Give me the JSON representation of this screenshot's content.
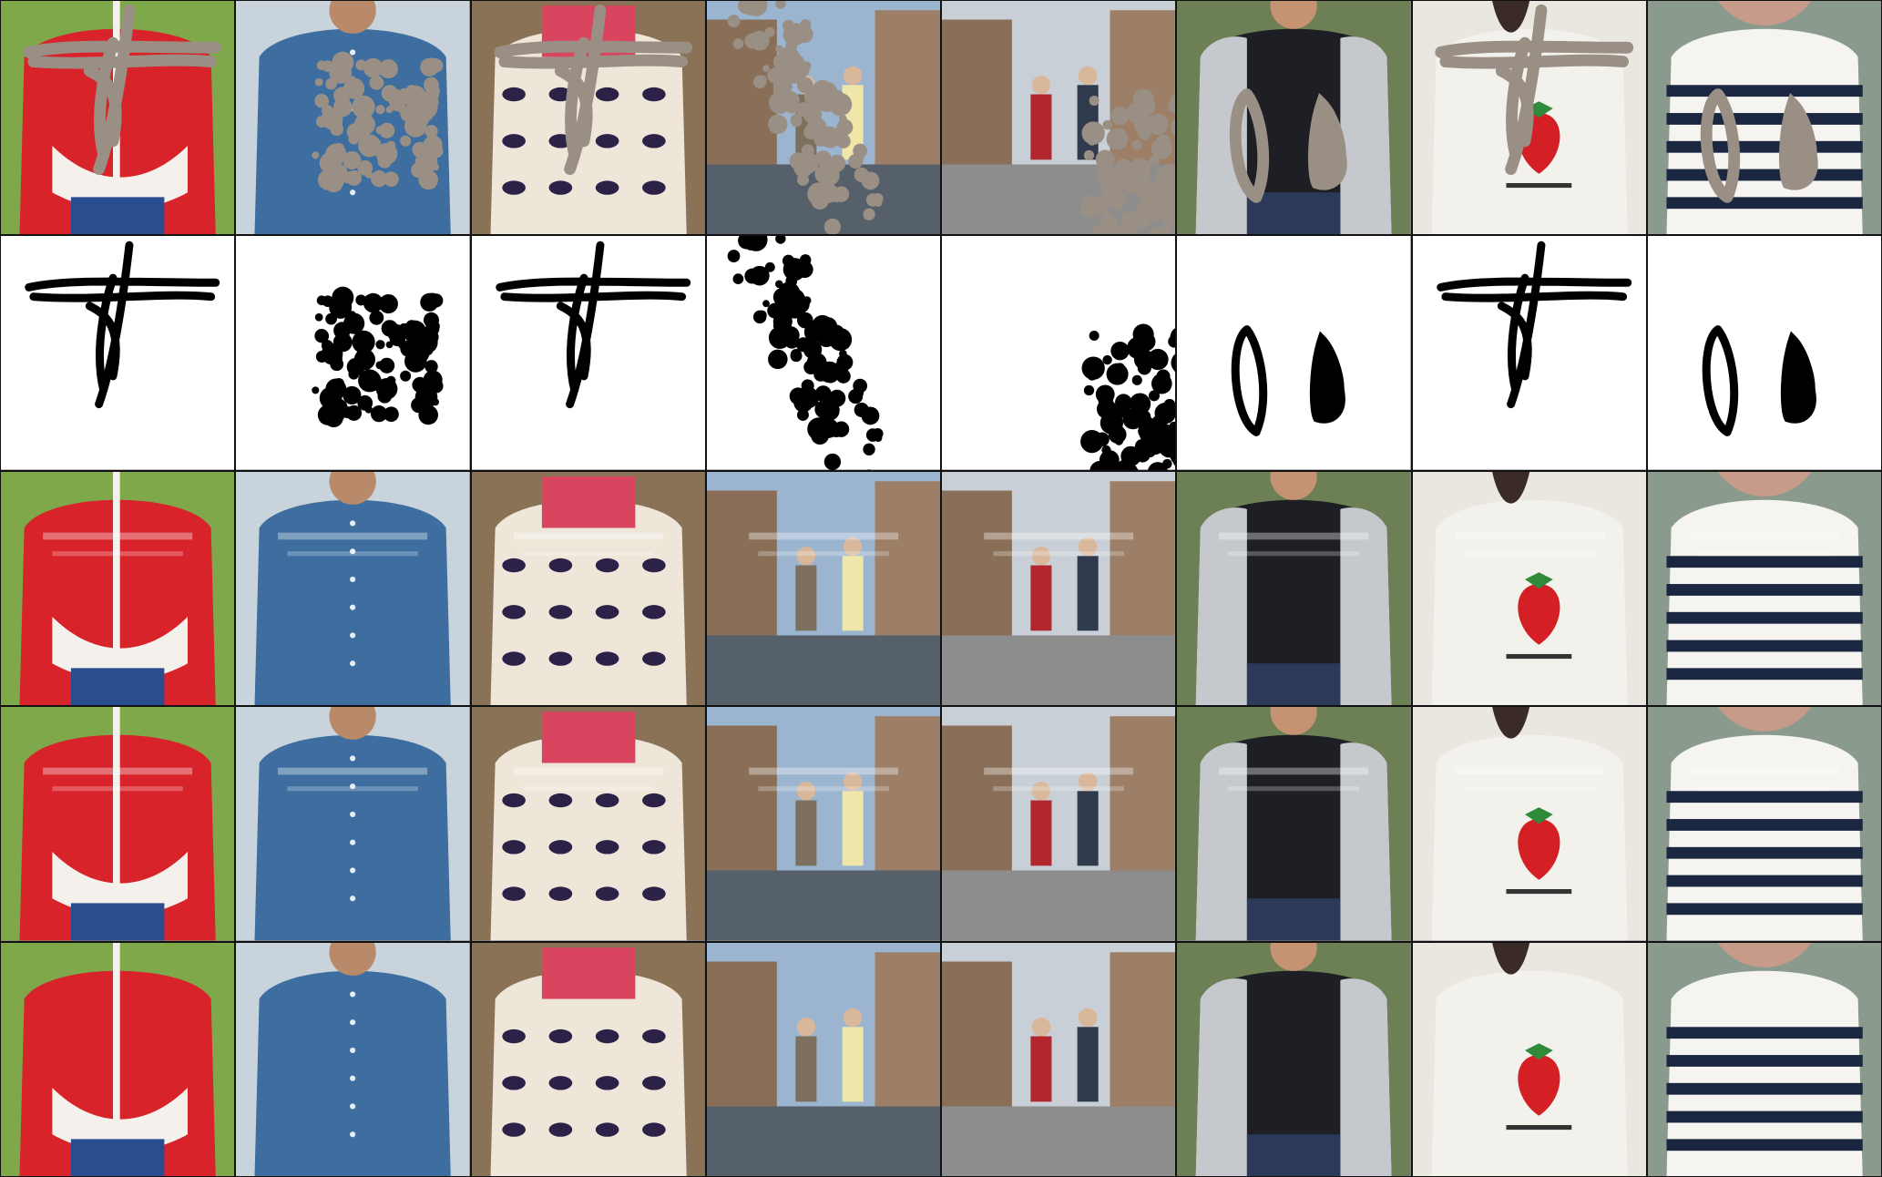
{
  "grid": {
    "rows": 5,
    "cols": 8,
    "row_roles": [
      "masked-input",
      "mask",
      "result",
      "result",
      "ground-truth"
    ],
    "scenes": [
      {
        "id": "red-jacket",
        "colors": {
          "bg": "#7fa84a",
          "garment": "#d8232a",
          "accent": "#f4f1ec",
          "lower": "#2a4d8f"
        }
      },
      {
        "id": "denim-shirt",
        "colors": {
          "bg": "#c9d3db",
          "garment": "#3d6e9f",
          "accent": "#2b4f75",
          "lower": "#6b6f74"
        }
      },
      {
        "id": "patterned-blouse",
        "colors": {
          "bg": "#8a7256",
          "garment": "#efe6da",
          "accent": "#d9445e",
          "lower": "#2c2247"
        }
      },
      {
        "id": "street-couple",
        "colors": {
          "bg": "#9bb4cf",
          "garment": "#7e705f",
          "accent": "#f1e6a9",
          "lower": "#56606a"
        }
      },
      {
        "id": "sidewalk-walkers",
        "colors": {
          "bg": "#c8cfd6",
          "garment": "#b3262e",
          "accent": "#2f3b4c",
          "lower": "#8d8d8d"
        }
      },
      {
        "id": "varsity-jacket",
        "colors": {
          "bg": "#6d7f55",
          "garment": "#1d1f24",
          "accent": "#c5c9ce",
          "lower": "#2c3a5a"
        }
      },
      {
        "id": "strawberry-tee",
        "colors": {
          "bg": "#eae7e0",
          "garment": "#f3f1ec",
          "accent": "#d42025",
          "lower": "#3a2b28"
        }
      },
      {
        "id": "striped-tee",
        "colors": {
          "bg": "#8a9a8c",
          "garment": "#f6f4f0",
          "accent": "#1b2640",
          "lower": "#c79b8a"
        }
      }
    ],
    "masks": [
      "cross",
      "blob",
      "cross",
      "blob-diagonal",
      "blob-corner",
      "pair-strokes",
      "cross",
      "pair-strokes"
    ],
    "mask_fill_color": "#9a8f84",
    "mask_ink_color": "#000000",
    "mask_background": "#ffffff"
  }
}
